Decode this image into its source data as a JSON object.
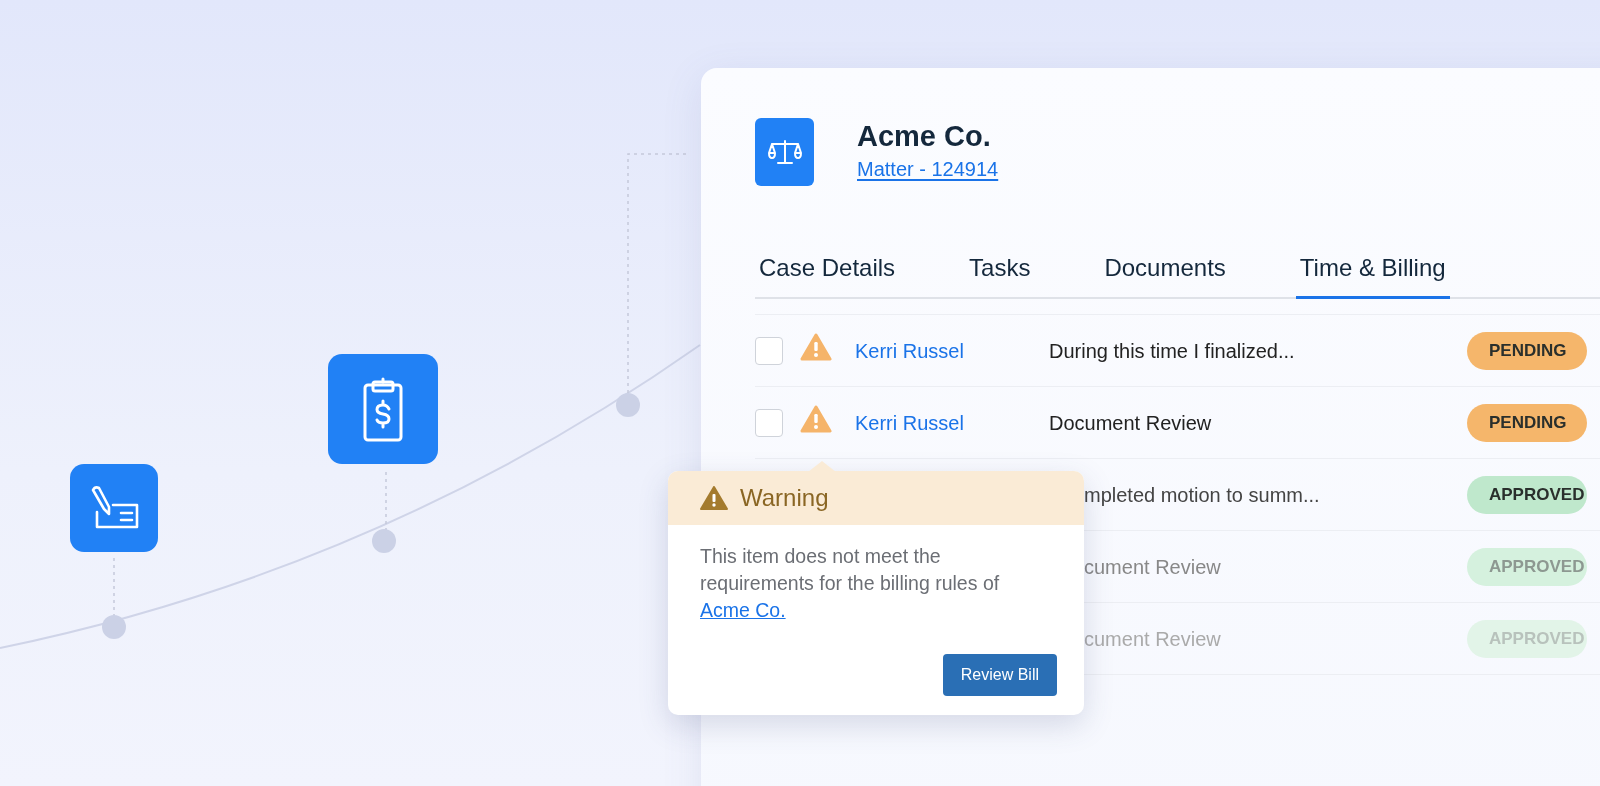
{
  "matter": {
    "title": "Acme Co.",
    "link": "Matter - 124914"
  },
  "tabs": [
    {
      "label": "Case Details",
      "selected": false
    },
    {
      "label": "Tasks",
      "selected": false
    },
    {
      "label": "Documents",
      "selected": false
    },
    {
      "label": "Time & Billing",
      "selected": true
    }
  ],
  "rows": [
    {
      "kind": "full",
      "checked": false,
      "warning": true,
      "name": "Kerri Russel",
      "description": "During this time I finalized...",
      "status": "PENDING",
      "color": "#f5b66b"
    },
    {
      "kind": "full",
      "checked": false,
      "warning": true,
      "name": "Kerri Russel",
      "description": "Document Review",
      "status": "PENDING",
      "color": "#f5b66b"
    },
    {
      "kind": "covered",
      "description": "mpleted motion to summ...",
      "status": "APPROVED",
      "color": "#bfe8cc"
    },
    {
      "kind": "covered",
      "description": "cument Review",
      "status": "APPROVED",
      "color": "#d5f1de"
    },
    {
      "kind": "covered",
      "description": "cument Review",
      "status": "APPROVED",
      "color": "#e2f4e8"
    }
  ],
  "popover": {
    "title": "Warning",
    "text": "This item does not meet the requirements for the billing rules of",
    "link": "Acme Co.",
    "button": "Review Bill"
  }
}
